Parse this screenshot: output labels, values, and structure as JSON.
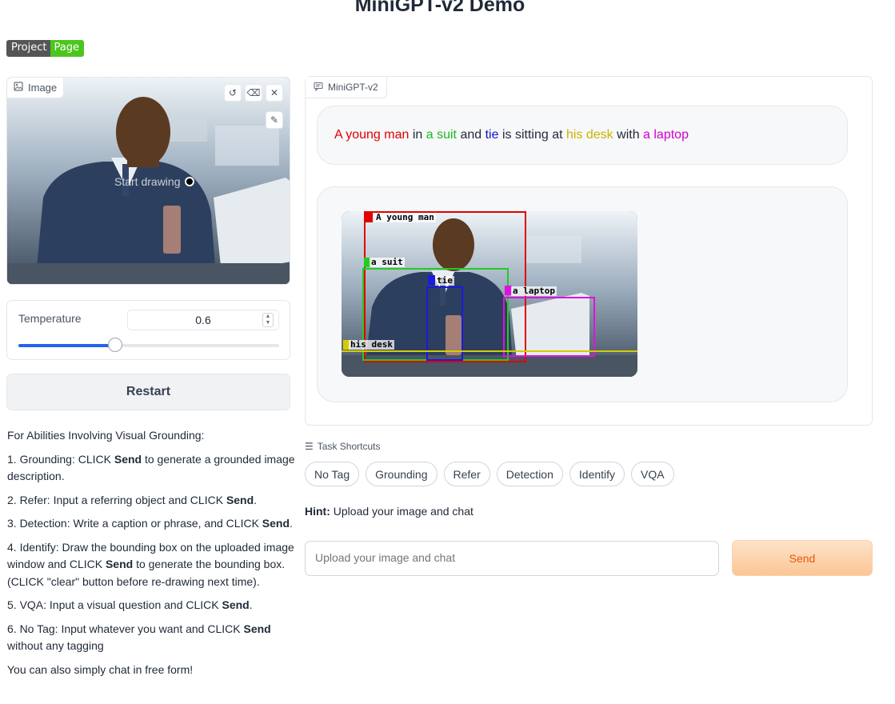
{
  "header": {
    "title": "MiniGPT-v2 Demo"
  },
  "badge": {
    "left": "Project",
    "right": "Page"
  },
  "image_panel": {
    "label": "Image",
    "overlay_text": "Start drawing",
    "icons": [
      "image-icon",
      "undo-icon",
      "eraser-icon",
      "close-icon",
      "brush-icon"
    ]
  },
  "temperature": {
    "label": "Temperature",
    "value": "0.6",
    "slider_fraction": 0.37
  },
  "restart_label": "Restart",
  "instructions": {
    "heading": "For Abilities Involving Visual Grounding:",
    "items": [
      {
        "pre": "1. Grounding: CLICK ",
        "bold": "Send",
        "post": " to generate a grounded image description."
      },
      {
        "pre": "2. Refer: Input a referring object and CLICK ",
        "bold": "Send",
        "post": "."
      },
      {
        "pre": "3. Detection: Write a caption or phrase, and CLICK ",
        "bold": "Send",
        "post": "."
      },
      {
        "pre": "4. Identify: Draw the bounding box on the uploaded image window and CLICK ",
        "bold": "Send",
        "post": " to generate the bounding box. (CLICK \"clear\" button before re-drawing next time)."
      },
      {
        "pre": "5. VQA: Input a visual question and CLICK ",
        "bold": "Send",
        "post": "."
      },
      {
        "pre": "6. No Tag: Input whatever you want and CLICK ",
        "bold": "Send",
        "post": " without any tagging"
      }
    ],
    "footer": "You can also simply chat in free form!"
  },
  "chatbot": {
    "label": "MiniGPT-v2",
    "response": [
      {
        "text": "A young man",
        "color": "#e00000"
      },
      {
        "text": " in ",
        "color": "#1f2937"
      },
      {
        "text": "a suit",
        "color": "#1fb81f"
      },
      {
        "text": " and ",
        "color": "#1f2937"
      },
      {
        "text": "tie",
        "color": "#1010c8"
      },
      {
        "text": " is sitting at ",
        "color": "#1f2937"
      },
      {
        "text": "his desk",
        "color": "#c8b400"
      },
      {
        "text": " with ",
        "color": "#1f2937"
      },
      {
        "text": "a laptop",
        "color": "#d000d0"
      }
    ],
    "boxes": [
      {
        "label": "A young man",
        "color": "#e00000"
      },
      {
        "label": "a suit",
        "color": "#22cc22"
      },
      {
        "label": "tie",
        "color": "#1a1ae0"
      },
      {
        "label": "a laptop",
        "color": "#e010e0"
      },
      {
        "label": "his desk",
        "color": "#d4cc00"
      }
    ]
  },
  "task_shortcuts": {
    "label": "Task Shortcuts",
    "buttons": [
      "No Tag",
      "Grounding",
      "Refer",
      "Detection",
      "Identify",
      "VQA"
    ]
  },
  "hint": {
    "bold": "Hint:",
    "text": " Upload your image and chat"
  },
  "input": {
    "placeholder": "Upload your image and chat",
    "send_label": "Send"
  }
}
